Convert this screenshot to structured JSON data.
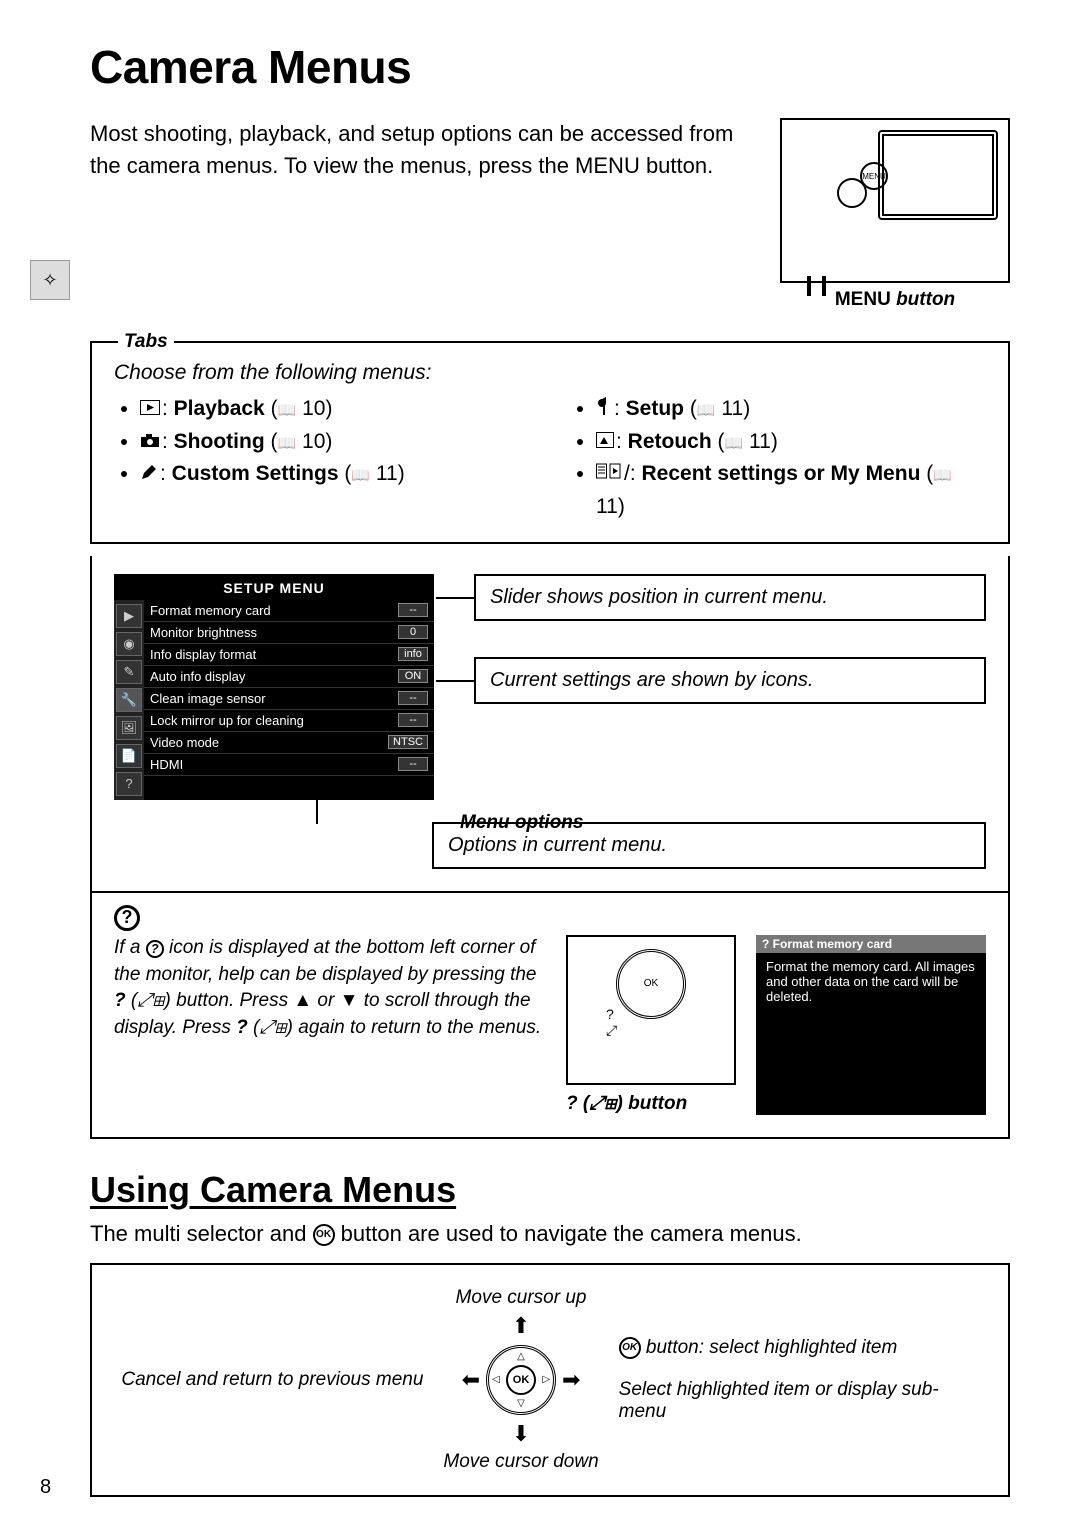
{
  "page_number": "8",
  "heading": "Camera Menus",
  "intro": "Most shooting, playback, and setup options can be accessed from the camera menus.  To view the menus, press the MENU button.",
  "camera_label_prefix": "MENU",
  "camera_label_suffix": " button",
  "tabs": {
    "legend": "Tabs",
    "desc": "Choose from the following menus:",
    "left": [
      {
        "name": "Playback",
        "page": "10"
      },
      {
        "name": "Shooting",
        "page": "10"
      },
      {
        "name": "Custom Settings",
        "page": "11"
      }
    ],
    "right": [
      {
        "name": "Setup",
        "page": "11"
      },
      {
        "name": "Retouch",
        "page": "11"
      },
      {
        "name": "Recent settings or My Menu",
        "page": "11"
      }
    ]
  },
  "menu_screenshot": {
    "title": "SETUP MENU",
    "items": [
      {
        "label": "Format memory card",
        "value": "--"
      },
      {
        "label": "Monitor brightness",
        "value": "0"
      },
      {
        "label": "Info display format",
        "value": "info"
      },
      {
        "label": "Auto info display",
        "value": "ON"
      },
      {
        "label": "Clean image sensor",
        "value": "--"
      },
      {
        "label": "Lock mirror up for cleaning",
        "value": "--"
      },
      {
        "label": "Video mode",
        "value": "NTSC"
      },
      {
        "label": "HDMI",
        "value": "--"
      }
    ]
  },
  "callouts": {
    "slider": "Slider shows position in current menu.",
    "current": "Current settings are shown by icons.",
    "options_legend": "Menu options",
    "options": "Options in current menu."
  },
  "help": {
    "text_1": "If a ",
    "text_2": " icon is displayed at the bottom left corner of the monitor, help can be displayed by pressing the ",
    "text_3": " button.  Press ▲ or ▼ to scroll through the display.  Press ",
    "text_4": " again to return to the menus.",
    "q_btn": "?",
    "zoom_glyph": "(⤢⊞)",
    "popup_title": "?  Format memory card",
    "popup_body": "Format the memory card. All images and other data on the card will be deleted.",
    "button_label": "? (⤢⊞) button"
  },
  "using": {
    "heading": "Using Camera Menus",
    "intro_1": "The multi selector and ",
    "intro_2": " button are used to navigate the camera menus.",
    "up": "Move cursor up",
    "down": "Move cursor down",
    "left": "Cancel and return to previous menu",
    "ok": " button: select highlighted item",
    "right": "Select highlighted item or display sub-menu"
  }
}
